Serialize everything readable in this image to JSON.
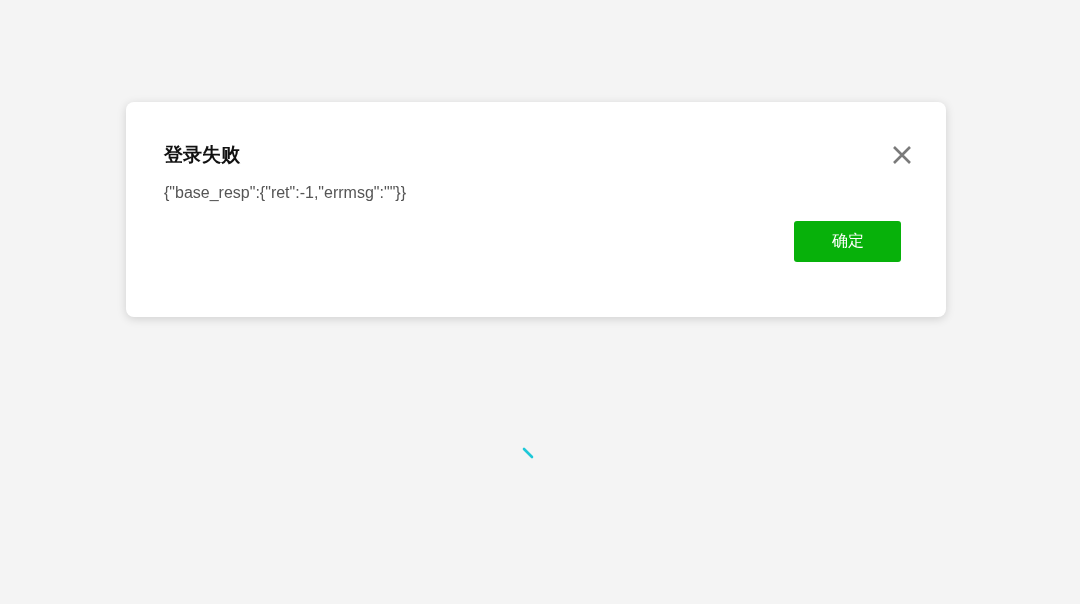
{
  "dialog": {
    "title": "登录失败",
    "message": "{\"base_resp\":{\"ret\":-1,\"errmsg\":\"\"}}",
    "buttons": [
      "确定"
    ]
  }
}
